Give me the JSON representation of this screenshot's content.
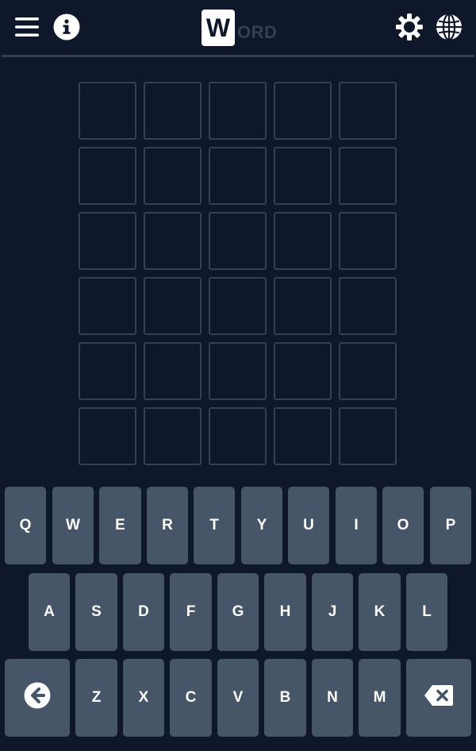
{
  "header": {
    "menu_icon": "hamburger-menu-icon",
    "info_icon": "info-icon",
    "logo_letter": "W",
    "logo_rest": "ORD",
    "settings_icon": "gear-icon",
    "language_icon": "globe-icon"
  },
  "board": {
    "rows": [
      [
        "",
        "",
        "",
        "",
        ""
      ],
      [
        "",
        "",
        "",
        "",
        ""
      ],
      [
        "",
        "",
        "",
        "",
        ""
      ],
      [
        "",
        "",
        "",
        "",
        ""
      ],
      [
        "",
        "",
        "",
        "",
        ""
      ],
      [
        "",
        "",
        "",
        "",
        ""
      ]
    ]
  },
  "keyboard": {
    "row1": [
      "Q",
      "W",
      "E",
      "R",
      "T",
      "Y",
      "U",
      "I",
      "O",
      "P"
    ],
    "row2": [
      "A",
      "S",
      "D",
      "F",
      "G",
      "H",
      "J",
      "K",
      "L"
    ],
    "row3": [
      "Z",
      "X",
      "C",
      "V",
      "B",
      "N",
      "M"
    ],
    "enter_icon": "arrow-left-circle-icon",
    "backspace_icon": "backspace-icon"
  },
  "colors": {
    "background": "#0f172a",
    "tile_border": "#334155",
    "key": "#475569",
    "text": "#ffffff"
  }
}
